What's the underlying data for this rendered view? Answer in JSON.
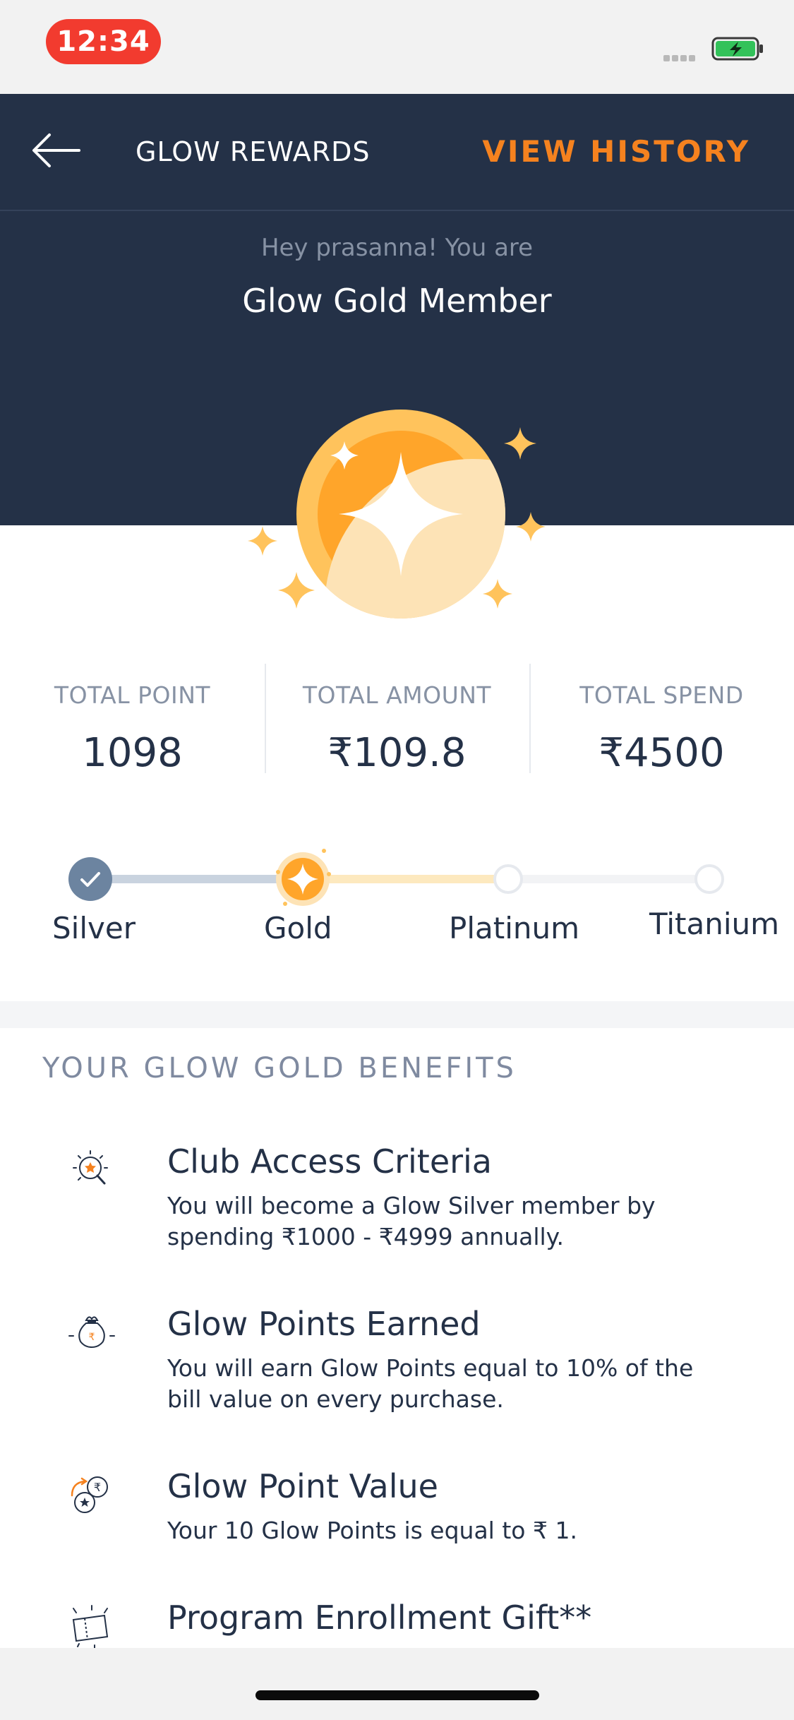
{
  "status_bar": {
    "time": "12:34",
    "battery_icon": "battery-charging-icon"
  },
  "header": {
    "back_icon": "arrow-left-icon",
    "title": "GLOW REWARDS",
    "view_history": "VIEW HISTORY"
  },
  "hero": {
    "greeting": "Hey prasanna! You are",
    "member_level": "Glow Gold Member",
    "medal_icon": "gold-star-medal-icon"
  },
  "stats": [
    {
      "label": "TOTAL POINT",
      "value": "1098"
    },
    {
      "label": "TOTAL AMOUNT",
      "value": "₹109.8"
    },
    {
      "label": "TOTAL SPEND",
      "value": "₹4500"
    }
  ],
  "tiers": {
    "items": [
      {
        "label": "Silver",
        "state": "completed"
      },
      {
        "label": "Gold",
        "state": "current"
      },
      {
        "label": "Platinum",
        "state": "upcoming"
      },
      {
        "label": "Titanium",
        "state": "upcoming"
      }
    ]
  },
  "benefits": {
    "title": "YOUR GLOW GOLD BENEFITS",
    "items": [
      {
        "icon": "star-badge-icon",
        "title": "Club Access Criteria",
        "description": "You will become a Glow Silver member by spending ₹1000 - ₹4999 annually."
      },
      {
        "icon": "money-bag-icon",
        "title": "Glow Points Earned",
        "description": "You will earn Glow Points equal to 10% of the bill value on every purchase."
      },
      {
        "icon": "coin-exchange-icon",
        "title": "Glow Point Value",
        "description": "Your 10 Glow Points is equal to ₹ 1."
      },
      {
        "icon": "gift-ticket-icon",
        "title": "Program Enrollment Gift**",
        "description": ""
      }
    ]
  },
  "colors": {
    "navy": "#243147",
    "accent_orange": "#f5821f",
    "gold": "#ffc35c",
    "silver_blue": "#6c84a0"
  }
}
